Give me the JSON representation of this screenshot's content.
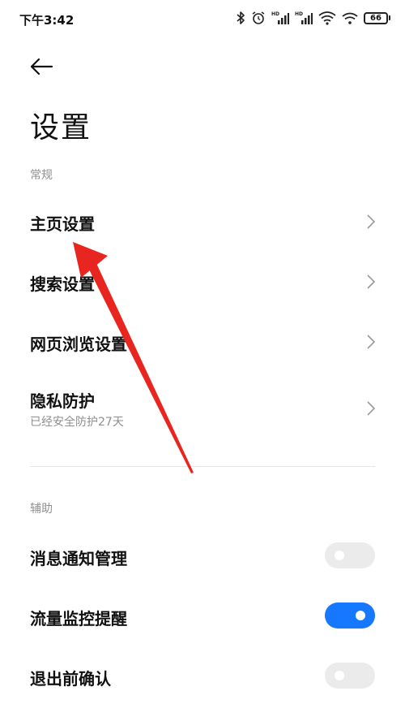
{
  "status_bar": {
    "time": "下午3:42",
    "signal_tag_1": "HD",
    "signal_tag_2": "HD",
    "battery_level": "66",
    "icons": [
      "bluetooth-icon",
      "alarm-icon",
      "signal-hd-icon",
      "signal-hd-icon",
      "wifi-icon",
      "wifi-icon",
      "battery-icon"
    ]
  },
  "header": {
    "back_icon": "arrow-left-icon",
    "title": "设置"
  },
  "sections": {
    "general": {
      "header": "常规",
      "items": [
        {
          "label": "主页设置"
        },
        {
          "label": "搜索设置"
        },
        {
          "label": "网页浏览设置"
        },
        {
          "label": "隐私防护",
          "sub": "已经安全防护27天"
        }
      ]
    },
    "assist": {
      "header": "辅助",
      "items": [
        {
          "label": "消息通知管理",
          "toggle": false
        },
        {
          "label": "流量监控提醒",
          "toggle": true
        },
        {
          "label": "退出前确认",
          "toggle": false
        }
      ]
    }
  },
  "colors": {
    "accent": "#1677ff",
    "annotation_arrow": "#e8251f",
    "muted_text": "#8f8f8f"
  }
}
